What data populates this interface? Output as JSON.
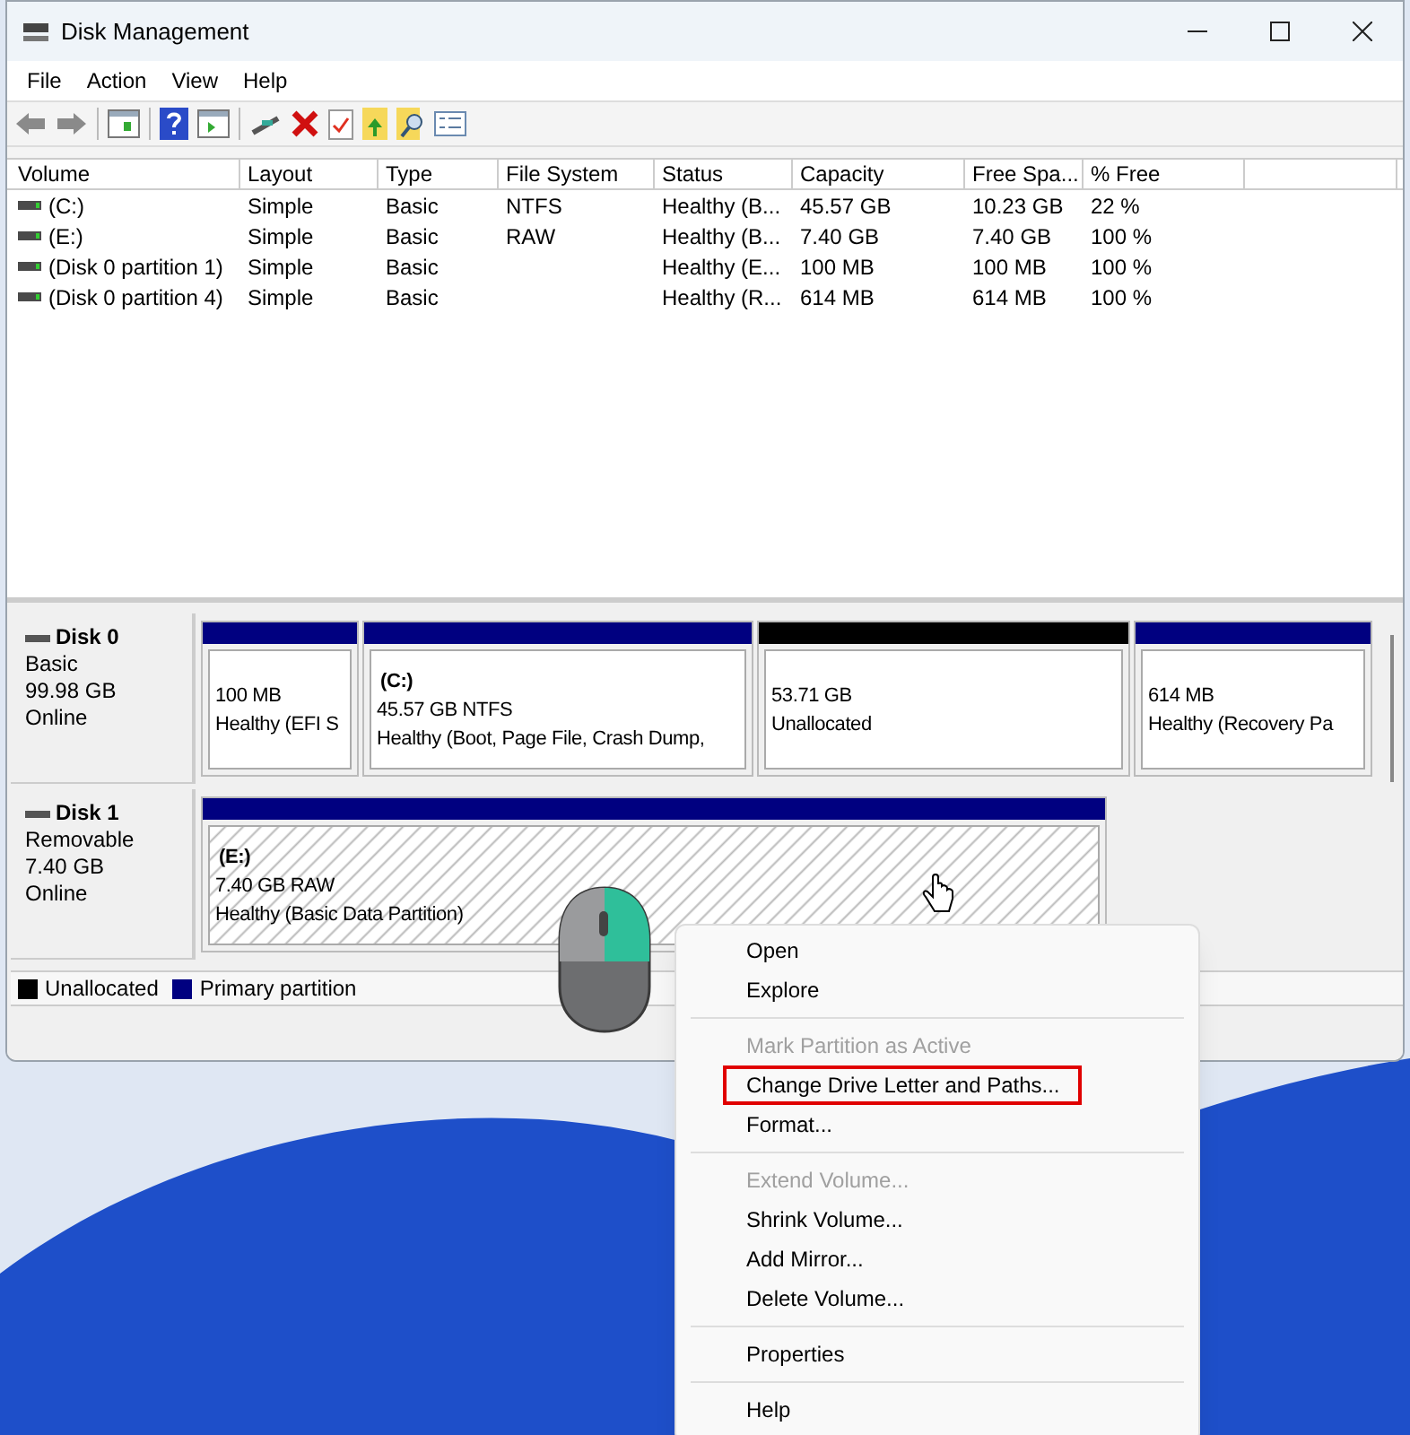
{
  "window": {
    "title": "Disk Management"
  },
  "menu_bar": [
    "File",
    "Action",
    "View",
    "Help"
  ],
  "volumes_table": {
    "columns": [
      "Volume",
      "Layout",
      "Type",
      "File System",
      "Status",
      "Capacity",
      "Free Spa...",
      "% Free"
    ],
    "rows": [
      [
        "(C:)",
        "Simple",
        "Basic",
        "NTFS",
        "Healthy (B...",
        "45.57 GB",
        "10.23 GB",
        "22 %"
      ],
      [
        "(E:)",
        "Simple",
        "Basic",
        "RAW",
        "Healthy (B...",
        "7.40 GB",
        "7.40 GB",
        "100 %"
      ],
      [
        "(Disk 0 partition 1)",
        "Simple",
        "Basic",
        "",
        "Healthy (E...",
        "100 MB",
        "100 MB",
        "100 %"
      ],
      [
        "(Disk 0 partition 4)",
        "Simple",
        "Basic",
        "",
        "Healthy (R...",
        "614 MB",
        "614 MB",
        "100 %"
      ]
    ]
  },
  "disks": [
    {
      "name": "Disk 0",
      "lines": [
        "Basic",
        "99.98 GB",
        "Online"
      ],
      "partitions": [
        {
          "kind": "primary",
          "selected": false,
          "lines": [
            "100 MB",
            "Healthy (EFI S"
          ]
        },
        {
          "kind": "primary",
          "selected": false,
          "label": "(C:)",
          "lines": [
            "45.57 GB NTFS",
            "Healthy (Boot, Page File, Crash Dump,"
          ]
        },
        {
          "kind": "unallocated",
          "selected": false,
          "lines": [
            "53.71 GB",
            "Unallocated"
          ]
        },
        {
          "kind": "primary",
          "selected": false,
          "lines": [
            "614 MB",
            "Healthy (Recovery Pa"
          ]
        }
      ]
    },
    {
      "name": "Disk 1",
      "lines": [
        "Removable",
        "7.40 GB",
        "Online"
      ],
      "partitions": [
        {
          "kind": "primary",
          "selected": true,
          "label": "(E:)",
          "lines": [
            "7.40 GB RAW",
            "Healthy (Basic Data Partition)"
          ]
        }
      ]
    }
  ],
  "legend": [
    {
      "label": "Unallocated",
      "color": "#000000"
    },
    {
      "label": "Primary partition",
      "color": "#000080"
    }
  ],
  "context_menu": [
    [
      {
        "label": "Open",
        "disabled": false,
        "highlighted": false
      },
      {
        "label": "Explore",
        "disabled": false,
        "highlighted": false
      }
    ],
    [
      {
        "label": "Mark Partition as Active",
        "disabled": true,
        "highlighted": false
      },
      {
        "label": "Change Drive Letter and Paths...",
        "disabled": false,
        "highlighted": true
      },
      {
        "label": "Format...",
        "disabled": false,
        "highlighted": false
      }
    ],
    [
      {
        "label": "Extend Volume...",
        "disabled": true,
        "highlighted": false
      },
      {
        "label": "Shrink Volume...",
        "disabled": false,
        "highlighted": false
      },
      {
        "label": "Add Mirror...",
        "disabled": false,
        "highlighted": false
      },
      {
        "label": "Delete Volume...",
        "disabled": false,
        "highlighted": false
      }
    ],
    [
      {
        "label": "Properties",
        "disabled": false,
        "highlighted": false
      }
    ],
    [
      {
        "label": "Help",
        "disabled": false,
        "highlighted": false
      }
    ]
  ]
}
